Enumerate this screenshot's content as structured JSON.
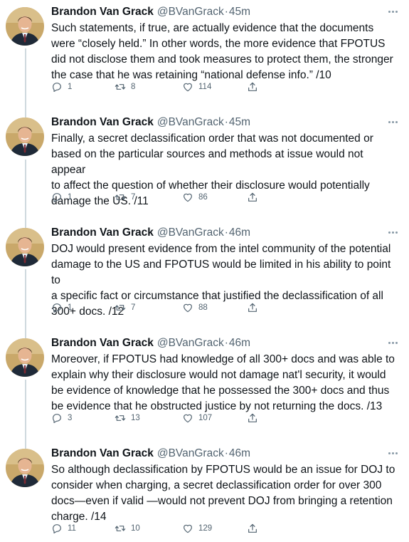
{
  "tweets": [
    {
      "name": "Brandon Van Grack",
      "handle": "@BVanGrack",
      "time": "45m",
      "text": "Such statements, if true, are actually evidence that the documents\nwere “closely held.” In other words, the more evidence that FPOTUS\ndid not disclose them and took measures to protect them, the stronger\nthe case that he was retaining “national defense info.” /10",
      "replies": "1",
      "retweets": "8",
      "likes": "114"
    },
    {
      "name": "Brandon Van Grack",
      "handle": "@BVanGrack",
      "time": "45m",
      "text": "Finally, a secret declassification order that was not documented or\nbased on the particular sources and methods at issue would not appear\nto affect the question of whether their disclosure would potentially\ndamage the US. /11",
      "replies": "1",
      "retweets": "7",
      "likes": "86"
    },
    {
      "name": "Brandon Van Grack",
      "handle": "@BVanGrack",
      "time": "46m",
      "text": "DOJ would present evidence from the intel community of the potential\ndamage to the US and FPOTUS would be limited in his ability to point to\na specific fact or circumstance that justified the declassification of all\n300+ docs. /12",
      "replies": "1",
      "retweets": "7",
      "likes": "88"
    },
    {
      "name": "Brandon Van Grack",
      "handle": "@BVanGrack",
      "time": "46m",
      "text": "Moreover, if FPOTUS had knowledge of all 300+ docs and was able to\nexplain why their disclosure would not damage nat'l security, it would\nbe evidence of knowledge that he possessed the 300+ docs and thus\nbe evidence that he obstructed justice by not returning the docs. /13",
      "replies": "3",
      "retweets": "13",
      "likes": "107"
    },
    {
      "name": "Brandon Van Grack",
      "handle": "@BVanGrack",
      "time": "46m",
      "text": "So although declassification by FPOTUS would be an issue for DOJ to\nconsider when charging, a secret declassification order for over 300\ndocs—even if valid —would not prevent DOJ from bringing a retention\ncharge. /14",
      "replies": "11",
      "retweets": "10",
      "likes": "129"
    }
  ],
  "separator": "·",
  "colors": {
    "text": "#0f1419",
    "secondary": "#536471",
    "thread_line": "#cfd9de"
  },
  "icons": [
    "reply-icon",
    "retweet-icon",
    "like-icon",
    "share-icon",
    "more-icon"
  ]
}
